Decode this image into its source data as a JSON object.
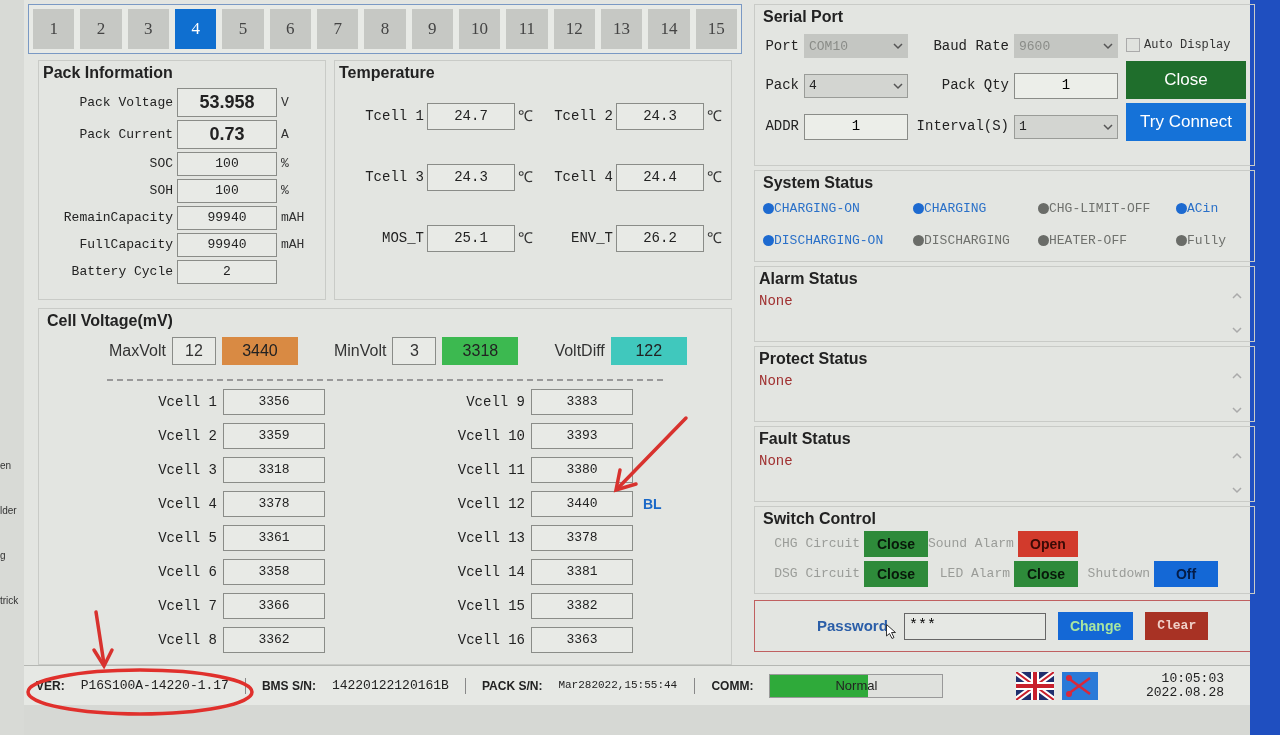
{
  "desktop_fragments": [
    "en",
    "lder",
    "g",
    "trick"
  ],
  "pack_tabs": [
    {
      "label": "1",
      "selected": false
    },
    {
      "label": "2",
      "selected": false
    },
    {
      "label": "3",
      "selected": false
    },
    {
      "label": "4",
      "selected": true
    },
    {
      "label": "5",
      "selected": false
    },
    {
      "label": "6",
      "selected": false
    },
    {
      "label": "7",
      "selected": false
    },
    {
      "label": "8",
      "selected": false
    },
    {
      "label": "9",
      "selected": false
    },
    {
      "label": "10",
      "selected": false
    },
    {
      "label": "11",
      "selected": false
    },
    {
      "label": "12",
      "selected": false
    },
    {
      "label": "13",
      "selected": false
    },
    {
      "label": "14",
      "selected": false
    },
    {
      "label": "15",
      "selected": false
    }
  ],
  "pack_information": {
    "title": "Pack Information",
    "fields": [
      {
        "label": "Pack Voltage",
        "value": "53.958",
        "unit": "V",
        "emphasis": true
      },
      {
        "label": "Pack Current",
        "value": "0.73",
        "unit": "A",
        "emphasis": true
      },
      {
        "label": "SOC",
        "value": "100",
        "unit": "%",
        "emphasis": false
      },
      {
        "label": "SOH",
        "value": "100",
        "unit": "%",
        "emphasis": false
      },
      {
        "label": "RemainCapacity",
        "value": "99940",
        "unit": "mAH",
        "emphasis": false
      },
      {
        "label": "FullCapacity",
        "value": "99940",
        "unit": "mAH",
        "emphasis": false
      },
      {
        "label": "Battery Cycle",
        "value": "2",
        "emphasis": false
      }
    ]
  },
  "temperature": {
    "title": "Temperature",
    "sensors": [
      {
        "label": "Tcell 1",
        "value": "24.7",
        "unit": "℃"
      },
      {
        "label": "Tcell 2",
        "value": "24.3",
        "unit": "℃"
      },
      {
        "label": "Tcell 3",
        "value": "24.3",
        "unit": "℃"
      },
      {
        "label": "Tcell 4",
        "value": "24.4",
        "unit": "℃"
      },
      {
        "label": "MOS_T",
        "value": "25.1",
        "unit": "℃"
      },
      {
        "label": "ENV_T",
        "value": "26.2",
        "unit": "℃"
      }
    ]
  },
  "cell_voltage": {
    "title": "Cell Voltage(mV)",
    "summary": [
      {
        "label": "MaxVolt",
        "cell": "12",
        "value": "3440",
        "color": "#d98a43"
      },
      {
        "label": "MinVolt",
        "cell": "3",
        "value": "3318",
        "color": "#3cb950"
      },
      {
        "label": "VoltDiff",
        "value": "122",
        "color": "#40c8bd"
      }
    ],
    "cells": [
      {
        "label": "Vcell 1",
        "value": "3356"
      },
      {
        "label": "Vcell 2",
        "value": "3359"
      },
      {
        "label": "Vcell 3",
        "value": "3318"
      },
      {
        "label": "Vcell 4",
        "value": "3378"
      },
      {
        "label": "Vcell 5",
        "value": "3361"
      },
      {
        "label": "Vcell 6",
        "value": "3358"
      },
      {
        "label": "Vcell 7",
        "value": "3366"
      },
      {
        "label": "Vcell 8",
        "value": "3362"
      },
      {
        "label": "Vcell 9",
        "value": "3383"
      },
      {
        "label": "Vcell 10",
        "value": "3393"
      },
      {
        "label": "Vcell 11",
        "value": "3380"
      },
      {
        "label": "Vcell 12",
        "value": "3440",
        "tag": "BL"
      },
      {
        "label": "Vcell 13",
        "value": "3378"
      },
      {
        "label": "Vcell 14",
        "value": "3381"
      },
      {
        "label": "Vcell 15",
        "value": "3382"
      },
      {
        "label": "Vcell 16",
        "value": "3363"
      }
    ]
  },
  "serial_port": {
    "title": "Serial Port",
    "port": {
      "label": "Port",
      "value": "COM10",
      "disabled": true
    },
    "baud_rate": {
      "label": "Baud Rate",
      "value": "9600",
      "disabled": true
    },
    "auto_display": {
      "label": "Auto Display",
      "checked": false
    },
    "pack": {
      "label": "Pack",
      "value": "4"
    },
    "pack_qty": {
      "label": "Pack Qty",
      "value": "1"
    },
    "addr": {
      "label": "ADDR",
      "value": "1"
    },
    "interval": {
      "label": "Interval(S)",
      "value": "1"
    },
    "buttons": [
      {
        "label": "Close",
        "kind": "close"
      },
      {
        "label": "Try Connect",
        "kind": "connect"
      }
    ]
  },
  "system_status": {
    "title": "System Status",
    "flags": [
      {
        "label": "CHARGING-ON",
        "on": true
      },
      {
        "label": "CHARGING",
        "on": true
      },
      {
        "label": "CHG-LIMIT-OFF",
        "on": false
      },
      {
        "label": "ACin",
        "on": true
      },
      {
        "label": "DISCHARGING-ON",
        "on": true
      },
      {
        "label": "DISCHARGING",
        "on": false
      },
      {
        "label": "HEATER-OFF",
        "on": false
      },
      {
        "label": "Fully",
        "on": false
      }
    ]
  },
  "status_boxes": [
    {
      "title": "Alarm Status",
      "text": "None"
    },
    {
      "title": "Protect Status",
      "text": "None"
    },
    {
      "title": "Fault Status",
      "text": "None"
    }
  ],
  "switch_control": {
    "title": "Switch Control",
    "switches": [
      {
        "label": "CHG Circuit",
        "state": "Close",
        "kind": "close"
      },
      {
        "label": "Sound Alarm",
        "state": "Open",
        "kind": "open"
      },
      {
        "label": "DSG Circuit",
        "state": "Close",
        "kind": "close"
      },
      {
        "label": "LED Alarm",
        "state": "Close",
        "kind": "close"
      },
      {
        "label": "Shutdown",
        "state": "Off",
        "kind": "off"
      }
    ]
  },
  "password": {
    "label": "Password",
    "value": "***",
    "buttons": [
      {
        "label": "Change",
        "kind": "change"
      },
      {
        "label": "Clear",
        "kind": "clear"
      }
    ]
  },
  "status_bar": {
    "version_label": "VER:",
    "version": "P16S100A-14220-1.17",
    "bms_sn_label": "BMS S/N:",
    "bms_sn": "14220122120161B",
    "pack_sn_label": "PACK S/N:",
    "pack_sn": "Mar282022,15:55:44",
    "comm_label": "COMM:",
    "comm_status": "Normal",
    "level": 0.57,
    "time": "10:05:03",
    "date": "2022.08.28"
  }
}
